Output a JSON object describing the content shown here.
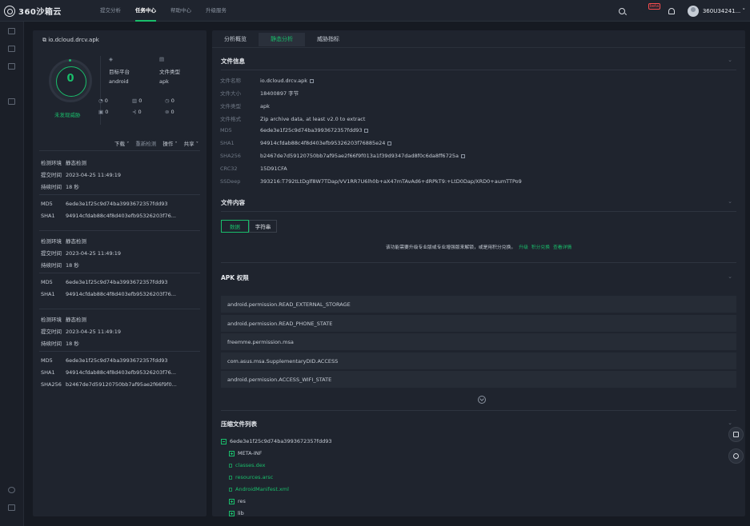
{
  "brand": "360沙箱云",
  "nav": [
    "提交分析",
    "任务中心",
    "帮助中心",
    "升级服务"
  ],
  "beta": "beta",
  "username": "360U34241... ˅",
  "left": {
    "filename": "io.dcloud.drcv.apk",
    "score": "0",
    "threat": "未发现威胁",
    "platform_label": "目标平台",
    "platform": "android",
    "type_label": "文件类型",
    "type": "apk",
    "stats": [
      "0",
      "0",
      "0",
      "0",
      "0",
      "0"
    ],
    "tools": {
      "download": "下载 ˅",
      "recheck": "重新检测",
      "ops": "操作 ˅",
      "share": "共享 ˅"
    },
    "runs": [
      {
        "env_k": "检测环境",
        "env": "静态检测",
        "time_k": "提交时间",
        "time": "2023-04-25 11:49:19",
        "dur_k": "持续时间",
        "dur": "18 秒",
        "md5": "6ede3e1f25c9d74ba3993672357fdd93",
        "sha1": "94914cfdab88c4f8d403efb95326203f76..."
      },
      {
        "env_k": "检测环境",
        "env": "静态检测",
        "time_k": "提交时间",
        "time": "2023-04-25 11:49:19",
        "dur_k": "持续时间",
        "dur": "18 秒",
        "md5": "6ede3e1f25c9d74ba3993672357fdd93",
        "sha1": "94914cfdab88c4f8d403efb95326203f76..."
      },
      {
        "env_k": "检测环境",
        "env": "静态检测",
        "time_k": "提交时间",
        "time": "2023-04-25 11:49:19",
        "dur_k": "持续时间",
        "dur": "18 秒",
        "md5": "6ede3e1f25c9d74ba3993672357fdd93",
        "sha1": "94914cfdab88c4f8d403efb95326203f76...",
        "sha256": "b2467de7d59120750bb7af95ae2f66f9f0..."
      }
    ],
    "md5_k": "MD5",
    "sha1_k": "SHA1",
    "sha256_k": "SHA256"
  },
  "tabs": [
    "分析概览",
    "静态分析",
    "威胁指标"
  ],
  "fileinfo": {
    "title": "文件信息",
    "rows": [
      [
        "文件名称",
        "io.dcloud.drcv.apk"
      ],
      [
        "文件大小",
        "18400897 字节"
      ],
      [
        "文件类型",
        "apk"
      ],
      [
        "文件格式",
        "Zip archive data, at least v2.0 to extract"
      ],
      [
        "MD5",
        "6ede3e1f25c9d74ba3993672357fdd93"
      ],
      [
        "SHA1",
        "94914cfdab88c4f8d403efb95326203f76885e24"
      ],
      [
        "SHA256",
        "b2467de7d59120750bb7af95ae2f66f9f013a1f39d9347dad8f0c6da8ff6725a"
      ],
      [
        "CRC32",
        "15D91CFA"
      ],
      [
        "SSDeep",
        "393216:T792tLtDglf8W7TDap/VV1RR7U6lh0b+aX47mTAvAd6+dRPkT9:+LtD0Dap/XRD0+aumTTPo9"
      ]
    ]
  },
  "content": {
    "title": "文件内容",
    "tab_data": "数据",
    "tab_str": "字符串",
    "notice": "该功能需要升级专业版或专业增强版来解锁，或是用积分兑换。",
    "links": [
      "升级",
      "积分兑换",
      "查看详情"
    ]
  },
  "perms": {
    "title": "APK 权限",
    "items": [
      "android.permission.READ_EXTERNAL_STORAGE",
      "android.permission.READ_PHONE_STATE",
      "freemme.permission.msa",
      "com.asus.msa.SupplementaryDID.ACCESS",
      "android.permission.ACCESS_WIFI_STATE"
    ]
  },
  "tree": {
    "title": "压缩文件列表",
    "root": "6ede3e1f25c9d74ba3993672357fdd93",
    "items": [
      "META-INF",
      "classes.dex",
      "resources.arsc",
      "AndroidManifest.xml",
      "res",
      "lib"
    ]
  }
}
